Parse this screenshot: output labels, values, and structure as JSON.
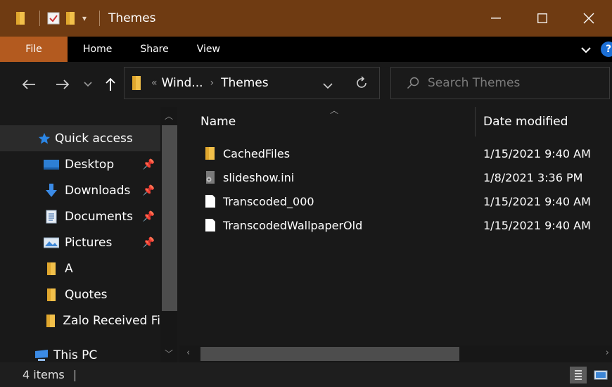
{
  "window": {
    "title": "Themes"
  },
  "ribbon": {
    "tabs": [
      "File",
      "Home",
      "Share",
      "View"
    ]
  },
  "address": {
    "overflow": "«",
    "path": [
      "Wind...",
      "Themes"
    ]
  },
  "search": {
    "placeholder": "Search Themes"
  },
  "navpane": {
    "items": [
      {
        "label": "Quick access",
        "icon": "star-icon",
        "pinned": false
      },
      {
        "label": "Desktop",
        "icon": "desktop-icon",
        "pinned": true
      },
      {
        "label": "Downloads",
        "icon": "download-arrow-icon",
        "pinned": true
      },
      {
        "label": "Documents",
        "icon": "document-icon",
        "pinned": true
      },
      {
        "label": "Pictures",
        "icon": "pictures-icon",
        "pinned": true
      },
      {
        "label": "A",
        "icon": "folder-icon",
        "pinned": false
      },
      {
        "label": "Quotes",
        "icon": "folder-icon",
        "pinned": false
      },
      {
        "label": "Zalo Received Fi",
        "icon": "folder-icon",
        "pinned": false
      },
      {
        "label": "This PC",
        "icon": "computer-icon",
        "pinned": false
      }
    ]
  },
  "columns": {
    "name": "Name",
    "date": "Date modified"
  },
  "files": [
    {
      "name": "CachedFiles",
      "date": "1/15/2021 9:40 AM",
      "icon": "folder-icon"
    },
    {
      "name": "slideshow.ini",
      "date": "1/8/2021 3:36 PM",
      "icon": "settings-file-icon"
    },
    {
      "name": "Transcoded_000",
      "date": "1/15/2021 9:40 AM",
      "icon": "file-icon"
    },
    {
      "name": "TranscodedWallpaperOld",
      "date": "1/15/2021 9:40 AM",
      "icon": "file-icon"
    }
  ],
  "status": {
    "count": "4 items",
    "divider": "|"
  },
  "colors": {
    "titlebar": "#6f3b12",
    "file_tab": "#b35a1f",
    "folder": "#f2c04a",
    "accent": "#1c6fd6"
  }
}
